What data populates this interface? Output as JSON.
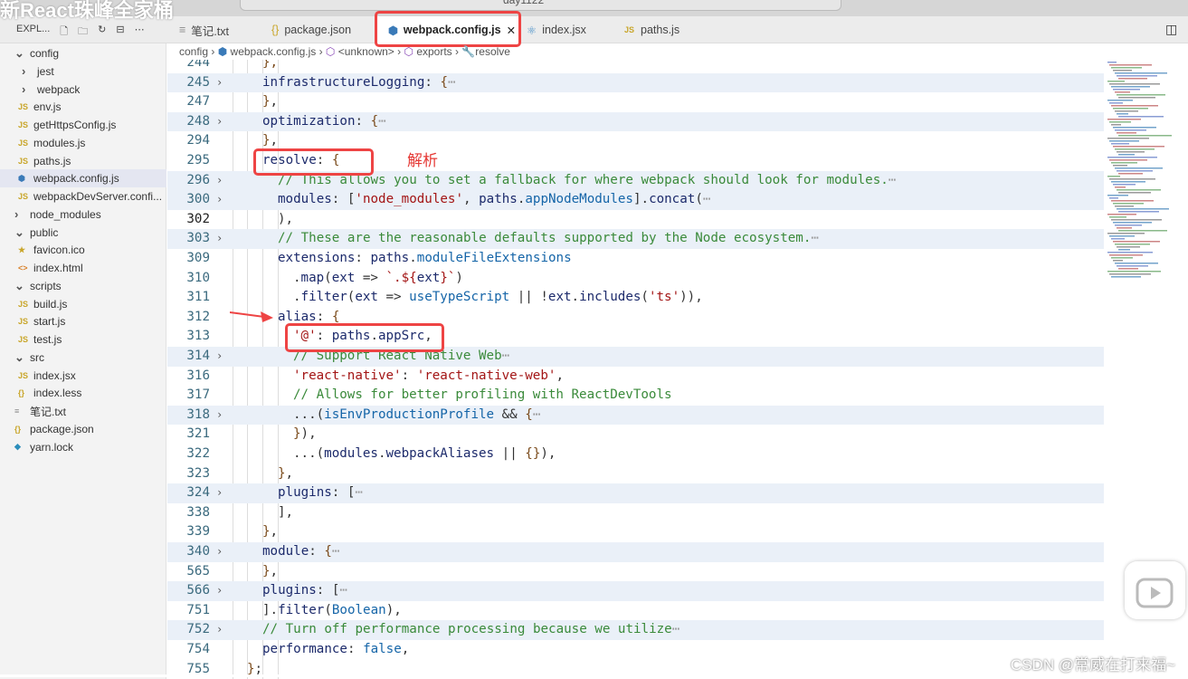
{
  "video_title": "新React珠峰全家桶",
  "search": "day1122",
  "explorer": {
    "label": "EXPL...",
    "actions": [
      "new-file",
      "new-folder",
      "refresh",
      "collapse",
      "more"
    ]
  },
  "tabs": [
    {
      "label": "笔记.txt",
      "icon": "text-file-icon",
      "active": false
    },
    {
      "label": "package.json",
      "icon": "json-icon",
      "active": false
    },
    {
      "label": "webpack.config.js",
      "icon": "webpack-icon",
      "active": true
    },
    {
      "label": "index.jsx",
      "icon": "react-icon",
      "active": false
    },
    {
      "label": "paths.js",
      "icon": "js-icon",
      "active": false
    }
  ],
  "breadcrumb": [
    "config",
    "webpack.config.js",
    "<unknown>",
    "exports",
    "resolve"
  ],
  "tree": [
    {
      "label": "config",
      "icon": "chevron-down",
      "level": 0
    },
    {
      "label": "jest",
      "icon": "chevron-right",
      "level": 1
    },
    {
      "label": "webpack",
      "icon": "chevron-right",
      "level": 1
    },
    {
      "label": "env.js",
      "icon": "JS",
      "level": 1
    },
    {
      "label": "getHttpsConfig.js",
      "icon": "JS",
      "level": 1
    },
    {
      "label": "modules.js",
      "icon": "JS",
      "level": 1
    },
    {
      "label": "paths.js",
      "icon": "JS",
      "level": 1
    },
    {
      "label": "webpack.config.js",
      "icon": "webpack",
      "level": 1,
      "selected": true
    },
    {
      "label": "webpackDevServer.confi...",
      "icon": "JS",
      "level": 1
    },
    {
      "label": "node_modules",
      "icon": "chevron-right",
      "level": 0
    },
    {
      "label": "public",
      "icon": "chevron-down",
      "level": 0
    },
    {
      "label": "favicon.ico",
      "icon": "star",
      "level": 1
    },
    {
      "label": "index.html",
      "icon": "html",
      "level": 1
    },
    {
      "label": "scripts",
      "icon": "chevron-down",
      "level": 0
    },
    {
      "label": "build.js",
      "icon": "JS",
      "level": 1
    },
    {
      "label": "start.js",
      "icon": "JS",
      "level": 1
    },
    {
      "label": "test.js",
      "icon": "JS",
      "level": 1
    },
    {
      "label": "src",
      "icon": "chevron-down",
      "level": 0
    },
    {
      "label": "index.jsx",
      "icon": "JS",
      "level": 1
    },
    {
      "label": "index.less",
      "icon": "braces",
      "level": 1
    },
    {
      "label": "笔记.txt",
      "icon": "text",
      "level": 0
    },
    {
      "label": "package.json",
      "icon": "braces",
      "level": 0
    },
    {
      "label": "yarn.lock",
      "icon": "yarn",
      "level": 0
    }
  ],
  "code": [
    {
      "n": "244",
      "i": 1,
      "t": [
        [
          "b",
          "},"
        ]
      ]
    },
    {
      "n": "245",
      "i": 1,
      "fold": true,
      "t": [
        [
          "p",
          "infrastructureLogging"
        ],
        [
          "t",
          ": "
        ],
        [
          "b",
          "{"
        ],
        [
          "e",
          "⋯"
        ]
      ]
    },
    {
      "n": "247",
      "i": 1,
      "t": [
        [
          "b",
          "}"
        ],
        [
          "t",
          ","
        ]
      ]
    },
    {
      "n": "248",
      "i": 1,
      "fold": true,
      "t": [
        [
          "p",
          "optimization"
        ],
        [
          "t",
          ": "
        ],
        [
          "b",
          "{"
        ],
        [
          "e",
          "⋯"
        ]
      ]
    },
    {
      "n": "294",
      "i": 1,
      "t": [
        [
          "b",
          "}"
        ],
        [
          "t",
          ","
        ]
      ]
    },
    {
      "n": "295",
      "i": 1,
      "t": [
        [
          "p",
          "resolve"
        ],
        [
          "t",
          ": "
        ],
        [
          "b",
          "{"
        ]
      ]
    },
    {
      "n": "296",
      "i": 2,
      "fold": true,
      "t": [
        [
          "c",
          "// This allows you to set a fallback for where webpack should look for modules."
        ],
        [
          "e",
          "⋯"
        ]
      ]
    },
    {
      "n": "300",
      "i": 2,
      "fold": true,
      "t": [
        [
          "p",
          "modules"
        ],
        [
          "t",
          ": ["
        ],
        [
          "s",
          "'node_modules'"
        ],
        [
          "t",
          ", "
        ],
        [
          "p",
          "paths"
        ],
        [
          "t",
          "."
        ],
        [
          "v",
          "appNodeModules"
        ],
        [
          "t",
          "]."
        ],
        [
          "f",
          "concat"
        ],
        [
          "t",
          "("
        ],
        [
          "e",
          "⋯"
        ]
      ]
    },
    {
      "n": "302",
      "i": 2,
      "cur": true,
      "t": [
        [
          "t",
          "),"
        ]
      ]
    },
    {
      "n": "303",
      "i": 2,
      "fold": true,
      "t": [
        [
          "c",
          "// These are the reasonable defaults supported by the Node ecosystem."
        ],
        [
          "e",
          "⋯"
        ]
      ]
    },
    {
      "n": "309",
      "i": 2,
      "t": [
        [
          "p",
          "extensions"
        ],
        [
          "t",
          ": "
        ],
        [
          "p",
          "paths"
        ],
        [
          "t",
          "."
        ],
        [
          "v",
          "moduleFileExtensions"
        ]
      ]
    },
    {
      "n": "310",
      "i": 3,
      "t": [
        [
          "t",
          "."
        ],
        [
          "f",
          "map"
        ],
        [
          "t",
          "("
        ],
        [
          "p",
          "ext"
        ],
        [
          "t",
          " => "
        ],
        [
          "s",
          "`.${"
        ],
        [
          "p",
          "ext"
        ],
        [
          "s",
          "}`"
        ],
        [
          "t",
          ")"
        ]
      ]
    },
    {
      "n": "311",
      "i": 3,
      "t": [
        [
          "t",
          "."
        ],
        [
          "f",
          "filter"
        ],
        [
          "t",
          "("
        ],
        [
          "p",
          "ext"
        ],
        [
          "t",
          " => "
        ],
        [
          "v",
          "useTypeScript"
        ],
        [
          "t",
          " || !"
        ],
        [
          "p",
          "ext"
        ],
        [
          "t",
          "."
        ],
        [
          "f",
          "includes"
        ],
        [
          "t",
          "("
        ],
        [
          "s",
          "'ts'"
        ],
        [
          "t",
          ")),"
        ]
      ]
    },
    {
      "n": "312",
      "i": 2,
      "t": [
        [
          "p",
          "alias"
        ],
        [
          "t",
          ": "
        ],
        [
          "b",
          "{"
        ]
      ]
    },
    {
      "n": "313",
      "i": 3,
      "t": [
        [
          "s",
          "'@'"
        ],
        [
          "t",
          ": "
        ],
        [
          "p",
          "paths"
        ],
        [
          "t",
          "."
        ],
        [
          "p",
          "appSrc"
        ],
        [
          "t",
          ","
        ]
      ]
    },
    {
      "n": "314",
      "i": 3,
      "fold": true,
      "t": [
        [
          "c",
          "// Support React Native Web"
        ],
        [
          "e",
          "⋯"
        ]
      ]
    },
    {
      "n": "316",
      "i": 3,
      "t": [
        [
          "s",
          "'react-native'"
        ],
        [
          "t",
          ": "
        ],
        [
          "s",
          "'react-native-web'"
        ],
        [
          "t",
          ","
        ]
      ]
    },
    {
      "n": "317",
      "i": 3,
      "t": [
        [
          "c",
          "// Allows for better profiling with ReactDevTools"
        ]
      ]
    },
    {
      "n": "318",
      "i": 3,
      "fold": true,
      "t": [
        [
          "t",
          "...("
        ],
        [
          "v",
          "isEnvProductionProfile"
        ],
        [
          "t",
          " && "
        ],
        [
          "b",
          "{"
        ],
        [
          "e",
          "⋯"
        ]
      ]
    },
    {
      "n": "321",
      "i": 3,
      "t": [
        [
          "b",
          "}"
        ],
        [
          "t",
          "),"
        ]
      ]
    },
    {
      "n": "322",
      "i": 3,
      "t": [
        [
          "t",
          "...("
        ],
        [
          "p",
          "modules"
        ],
        [
          "t",
          "."
        ],
        [
          "p",
          "webpackAliases"
        ],
        [
          "t",
          " || "
        ],
        [
          "b",
          "{}"
        ],
        [
          "t",
          "),"
        ]
      ]
    },
    {
      "n": "323",
      "i": 2,
      "t": [
        [
          "b",
          "}"
        ],
        [
          "t",
          ","
        ]
      ]
    },
    {
      "n": "324",
      "i": 2,
      "fold": true,
      "t": [
        [
          "p",
          "plugins"
        ],
        [
          "t",
          ": ["
        ],
        [
          "e",
          "⋯"
        ]
      ]
    },
    {
      "n": "338",
      "i": 2,
      "t": [
        [
          "t",
          "],"
        ]
      ]
    },
    {
      "n": "339",
      "i": 1,
      "t": [
        [
          "b",
          "}"
        ],
        [
          "t",
          ","
        ]
      ]
    },
    {
      "n": "340",
      "i": 1,
      "fold": true,
      "t": [
        [
          "p",
          "module"
        ],
        [
          "t",
          ": "
        ],
        [
          "b",
          "{"
        ],
        [
          "e",
          "⋯"
        ]
      ]
    },
    {
      "n": "565",
      "i": 1,
      "t": [
        [
          "b",
          "}"
        ],
        [
          "t",
          ","
        ]
      ]
    },
    {
      "n": "566",
      "i": 1,
      "fold": true,
      "t": [
        [
          "p",
          "plugins"
        ],
        [
          "t",
          ": ["
        ],
        [
          "e",
          "⋯"
        ]
      ]
    },
    {
      "n": "751",
      "i": 1,
      "t": [
        [
          "t",
          "]."
        ],
        [
          "f",
          "filter"
        ],
        [
          "t",
          "("
        ],
        [
          "v",
          "Boolean"
        ],
        [
          "t",
          "),"
        ]
      ]
    },
    {
      "n": "752",
      "i": 1,
      "fold": true,
      "t": [
        [
          "c",
          "// Turn off performance processing because we utilize"
        ],
        [
          "e",
          "⋯"
        ]
      ]
    },
    {
      "n": "754",
      "i": 1,
      "t": [
        [
          "p",
          "performance"
        ],
        [
          "t",
          ": "
        ],
        [
          "v",
          "false"
        ],
        [
          "t",
          ","
        ]
      ]
    },
    {
      "n": "755",
      "i": 0,
      "t": [
        [
          "b",
          "}"
        ],
        [
          "t",
          ";"
        ]
      ]
    }
  ],
  "annotation": "解析",
  "csdn": "CSDN @常威在打来福~"
}
